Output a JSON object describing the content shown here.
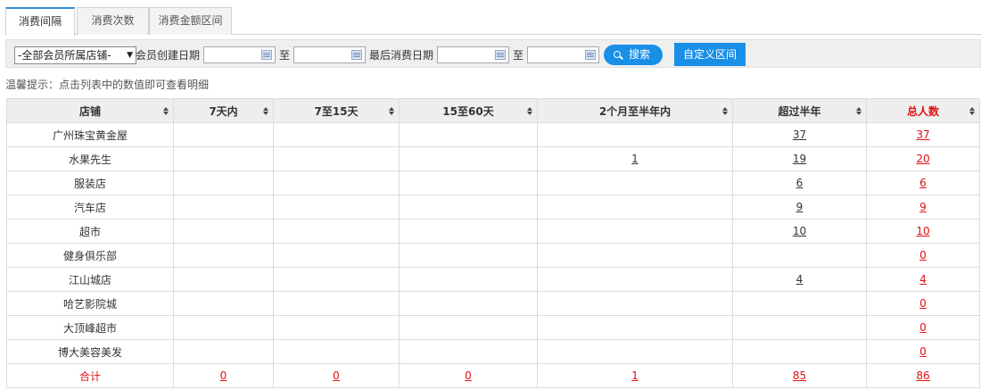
{
  "tabs": [
    {
      "label": "消费间隔",
      "active": true
    },
    {
      "label": "消费次数",
      "active": false
    },
    {
      "label": "消费金额区间",
      "active": false
    }
  ],
  "filter": {
    "store_select": "-全部会员所属店铺-",
    "created_label": "会员创建日期",
    "to_label": "至",
    "last_consume_label": "最后消费日期",
    "search_label": "搜索",
    "custom_range_label": "自定义区间",
    "created_from": "",
    "created_to": "",
    "last_from": "",
    "last_to": ""
  },
  "tip": "温馨提示：点击列表中的数值即可查看明细",
  "table": {
    "headers": [
      "店铺",
      "7天内",
      "7至15天",
      "15至60天",
      "2个月至半年内",
      "超过半年",
      "总人数"
    ],
    "rows": [
      {
        "store": "广州珠宝黄金屋",
        "d7": "",
        "d15": "",
        "d60": "",
        "m6": "",
        "over": "37",
        "total": "37"
      },
      {
        "store": "水果先生",
        "d7": "",
        "d15": "",
        "d60": "",
        "m6": "1",
        "over": "19",
        "total": "20"
      },
      {
        "store": "服装店",
        "d7": "",
        "d15": "",
        "d60": "",
        "m6": "",
        "over": "6",
        "total": "6"
      },
      {
        "store": "汽车店",
        "d7": "",
        "d15": "",
        "d60": "",
        "m6": "",
        "over": "9",
        "total": "9"
      },
      {
        "store": "超市",
        "d7": "",
        "d15": "",
        "d60": "",
        "m6": "",
        "over": "10",
        "total": "10"
      },
      {
        "store": "健身俱乐部",
        "d7": "",
        "d15": "",
        "d60": "",
        "m6": "",
        "over": "",
        "total": "0"
      },
      {
        "store": "江山城店",
        "d7": "",
        "d15": "",
        "d60": "",
        "m6": "",
        "over": "4",
        "total": "4"
      },
      {
        "store": "哈艺影院城",
        "d7": "",
        "d15": "",
        "d60": "",
        "m6": "",
        "over": "",
        "total": "0"
      },
      {
        "store": "大顶峰超市",
        "d7": "",
        "d15": "",
        "d60": "",
        "m6": "",
        "over": "",
        "total": "0"
      },
      {
        "store": "博大美容美发",
        "d7": "",
        "d15": "",
        "d60": "",
        "m6": "",
        "over": "",
        "total": "0"
      }
    ],
    "total": {
      "label": "合计",
      "d7": "0",
      "d15": "0",
      "d60": "0",
      "m6": "1",
      "over": "85",
      "total": "86"
    }
  },
  "colors": {
    "accent": "#1a8fe8",
    "highlight": "#e01010"
  }
}
